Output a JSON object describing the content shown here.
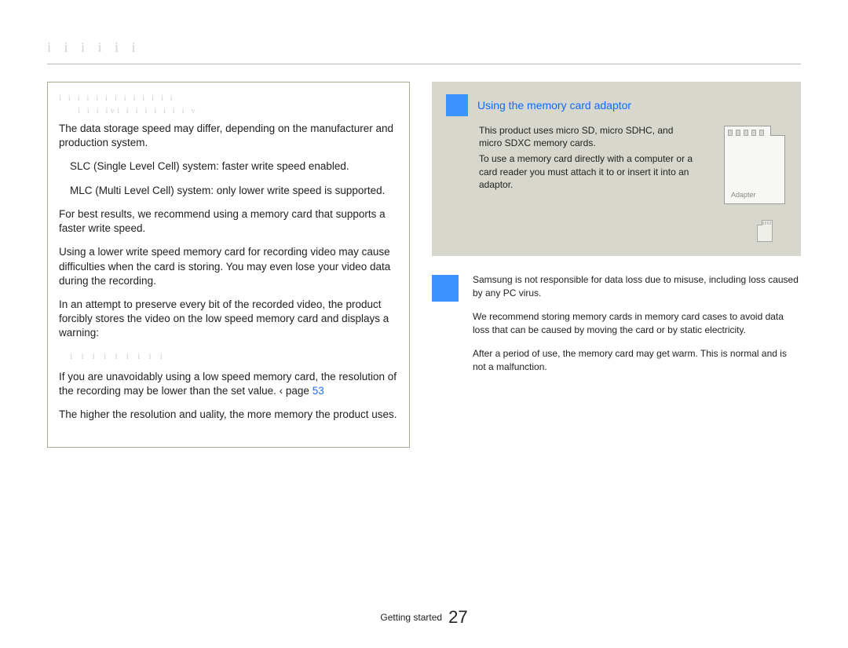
{
  "header": {
    "breadcrumb_ghost": "i   i      i   i        i          i"
  },
  "leftbox": {
    "title_ghost_1": "i  i        i         i i     i   i i    i     i    i i    i",
    "title_ghost_2": "i      i       i  ivi    i   i i     i    i    i    i        v",
    "p1": "The data storage speed may differ, depending on the manufacturer and production system.",
    "b1": "SLC (Single Level Cell) system: faster write speed enabled.",
    "b2": "MLC (Multi Level Cell) system: only lower write speed is supported.",
    "p2": "For best results, we recommend using a memory card that supports a faster write speed.",
    "p3": "Using a lower write speed memory card for recording video may cause difficulties when the card is storing. You may even lose your video data during the recording.",
    "p4": "In an attempt to preserve every bit of the recorded video, the product forcibly stores the video on the low speed memory card and displays a warning:",
    "warning_ghost": "i      i     i       i       i   i i     i       i",
    "p5a": "If you are unavoidably using a low speed memory card, the resolution of the recording may be lower than the set value.  ‹ page ",
    "p5_pageref": "53",
    "p6": "The higher the resolution and  uality, the more memory the product uses."
  },
  "tipbox": {
    "title": "Using the memory card adaptor",
    "line1": "This product uses micro SD, micro SDHC, and micro SDXC memory cards.",
    "line2": "To use a memory card directly with a computer or a card reader you must attach it to or insert it into an adaptor.",
    "adapter_label": "Adapter"
  },
  "notes": {
    "n1": "Samsung is not responsible for data loss due to misuse, including loss caused by any PC virus.",
    "n2": "We recommend storing memory cards in memory card cases to avoid data loss that can be caused by moving the card or by static electricity.",
    "n3": "After a period of use, the memory card may get warm. This is normal and is not a malfunction."
  },
  "footer": {
    "section": "Getting started",
    "page": "27"
  }
}
